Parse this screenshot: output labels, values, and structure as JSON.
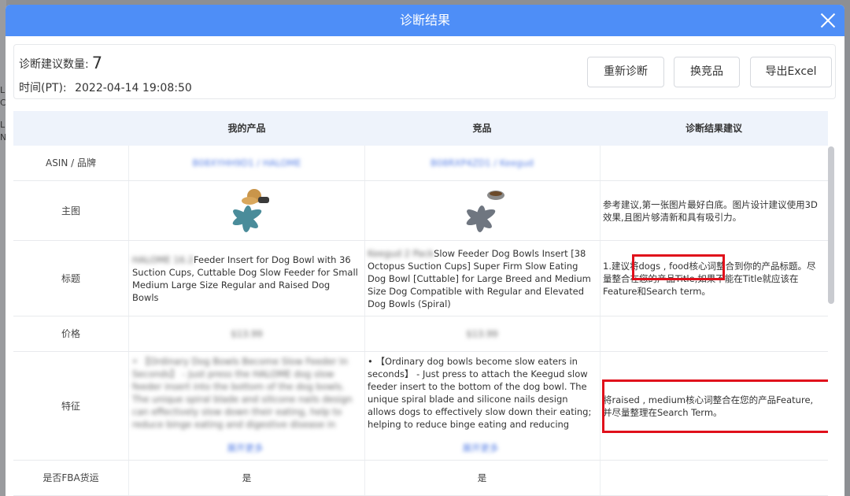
{
  "modal": {
    "title": "诊断结果"
  },
  "summary": {
    "count_label": "诊断建议数量:",
    "count_value": "7",
    "time_label": "时间(PT):",
    "time_value": "2022-04-14 19:08:50",
    "buttons": {
      "rediagnose": "重新诊断",
      "change_competitor": "换竞品",
      "export": "导出Excel"
    }
  },
  "table": {
    "headers": [
      "",
      "我的产品",
      "竞品",
      "诊断结果建议"
    ],
    "rows": {
      "asin": {
        "label": "ASIN / 品牌",
        "mine": "B08XYHH9D1 / HALOME",
        "comp": "B08RXP4ZD1 / Keegud",
        "advice": ""
      },
      "image": {
        "label": "主图",
        "advice": "参考建议,第一张图片最好白底。图片设计建议使用3D效果,且图片够清新和具有吸引力。"
      },
      "title": {
        "label": "标题",
        "mine_prefix": "HALOME 16.2",
        "mine": "Feeder Insert for Dog Bowl with 36 Suction Cups, Cuttable Dog Slow Feeder for Small Medium Large Size Regular and Raised Dog Bowls",
        "comp_prefix": "Keegud 2 Pack",
        "comp": "Slow Feeder Dog Bowls Insert [38 Octopus Suction Cups] Super Firm Slow Eating Dog Bowl [Cuttable] for Large Breed and Medium Size Dog Compatible with Regular and Elevated Dog Bowls (Spiral)",
        "advice": "1.建议将dogs , food核心词整合到你的产品标题。尽量整合在您的产品Title,如果不能在Title就应该在Feature和Search term。"
      },
      "price": {
        "label": "价格",
        "mine": "$13.99",
        "comp": "$13.99"
      },
      "feature": {
        "label": "特征",
        "mine": "• 【Ordinary Dog Bowls Become Slow Feeder In Seconds】 - Just press the HALOME dog slow feeder insert into the bottom of the dog bowls. The unique spiral blade and silicone nails design can effectively slow down their eating, help to reduce binge eating and digestive disease in dogs ...",
        "mine_more": "展开更多",
        "comp": "• 【Ordinary dog bowls become slow eaters in seconds】 - Just press to attach the Keegud slow feeder insert to the bottom of the dog bowl. The unique spiral blade and silicone nails design allows dogs to effectively slow down their eating; helping to reduce binge eating and reducing digestive disease i...",
        "comp_more": "展开更多",
        "advice": "将raised , medium核心词整合在您的产品Feature,并尽量整理在Search Term。"
      },
      "fba": {
        "label": "是否FBA货运",
        "mine": "是",
        "comp": "是"
      }
    }
  },
  "colors": {
    "header_blue": "#4e8ef7",
    "highlight_red": "#e0101b",
    "table_head": "#eef3fb"
  },
  "icons": {
    "close": "close-icon"
  }
}
